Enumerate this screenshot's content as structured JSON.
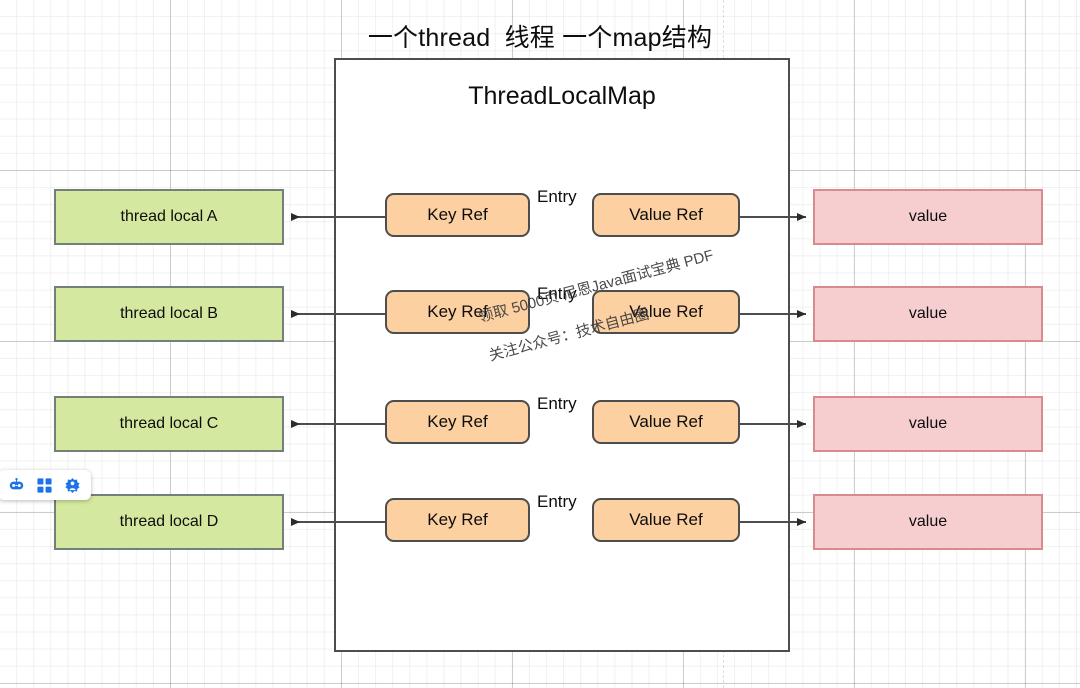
{
  "diagram": {
    "title": "一个thread  线程 一个map结构",
    "container_label": "ThreadLocalMap",
    "entry_label": "Entry",
    "rows": [
      {
        "thread_local": "thread local A",
        "key_ref": "Key Ref",
        "entry": "Entry",
        "value_ref": "Value Ref",
        "value": "value"
      },
      {
        "thread_local": "thread local B",
        "key_ref": "Key Ref",
        "entry": "Entry",
        "value_ref": "Value Ref",
        "value": "value"
      },
      {
        "thread_local": "thread local C",
        "key_ref": "Key Ref",
        "entry": "Entry",
        "value_ref": "Value Ref",
        "value": "value"
      },
      {
        "thread_local": "thread local D",
        "key_ref": "Key Ref",
        "entry": "Entry",
        "value_ref": "Value Ref",
        "value": "value"
      }
    ]
  },
  "watermark": {
    "line1": "领取 5000页 尼恩Java面试宝典 PDF",
    "line2": "关注公众号：技术自由圈"
  },
  "toolbar": {
    "items": [
      {
        "name": "robot-icon",
        "label": "robot-assistant"
      },
      {
        "name": "grid-apps-icon",
        "label": "apps-grid"
      },
      {
        "name": "gear-person-icon",
        "label": "settings-agent"
      }
    ]
  },
  "colors": {
    "thread_local_fill": "#d5e8a0",
    "thread_local_stroke": "#73807a",
    "ref_fill": "#fcd0a1",
    "ref_stroke": "#4d4d4d",
    "value_fill": "#f7ced0",
    "value_stroke": "#d98a8e",
    "container_stroke": "#4d4d4d",
    "arrow_stroke": "#4d4d4d",
    "toolbar_accent": "#1a73e8"
  }
}
